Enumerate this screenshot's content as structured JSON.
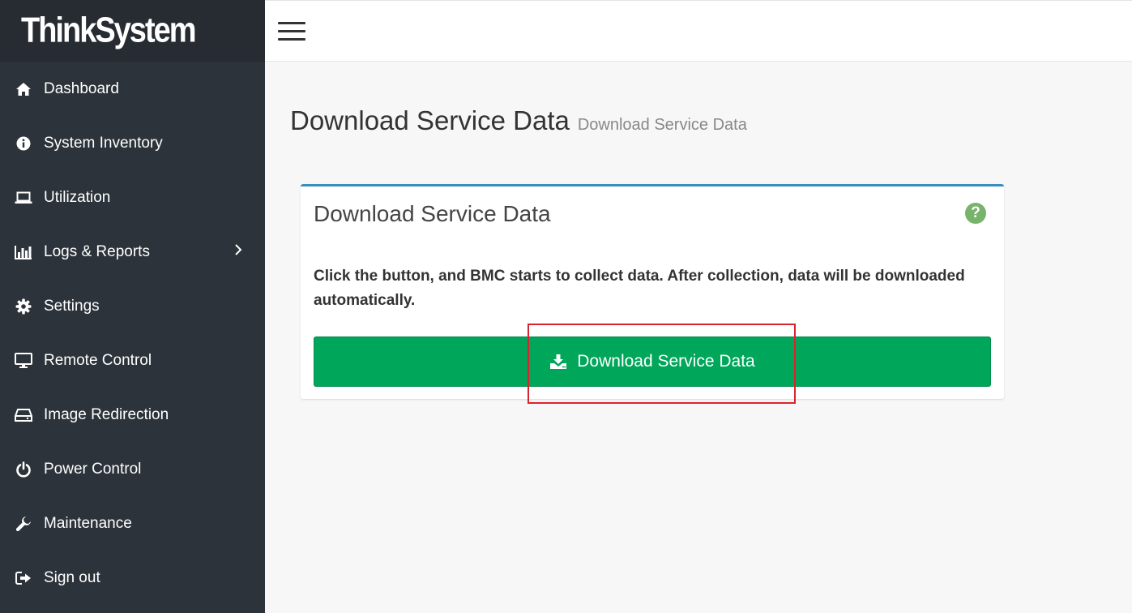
{
  "app": {
    "logo": "ThinkSystem"
  },
  "sidebar": {
    "items": [
      {
        "label": "Dashboard",
        "icon": "home-icon"
      },
      {
        "label": "System Inventory",
        "icon": "info-icon"
      },
      {
        "label": "Utilization",
        "icon": "laptop-icon"
      },
      {
        "label": "Logs & Reports",
        "icon": "bar-chart-icon"
      },
      {
        "label": "Settings",
        "icon": "gear-icon"
      },
      {
        "label": "Remote Control",
        "icon": "monitor-icon"
      },
      {
        "label": "Image Redirection",
        "icon": "drive-icon"
      },
      {
        "label": "Power Control",
        "icon": "power-icon"
      },
      {
        "label": "Maintenance",
        "icon": "wrench-icon"
      },
      {
        "label": "Sign out",
        "icon": "sign-out-icon"
      }
    ]
  },
  "page": {
    "title": "Download Service Data",
    "subtitle": "Download Service Data"
  },
  "box": {
    "title": "Download Service Data",
    "help": "?",
    "description": "Click the button, and BMC starts to collect data. After collection, data will be downloaded automatically.",
    "button_label": "Download Service Data"
  },
  "colors": {
    "sidebar_bg": "#2c333a",
    "accent": "#3c8dbc",
    "button": "#00a65a",
    "help": "#77b36b",
    "highlight": "#d9232d"
  }
}
